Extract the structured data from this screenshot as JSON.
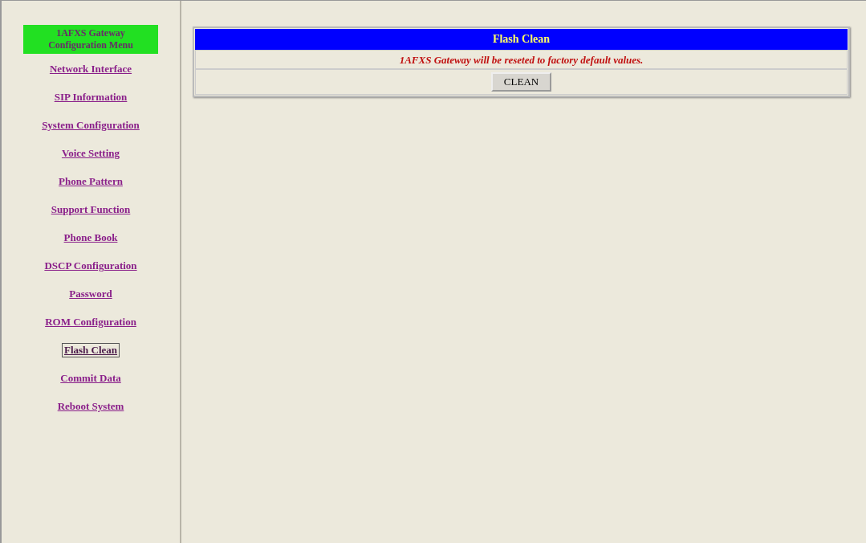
{
  "menu": {
    "title": "1AFXS Gateway Configuration Menu",
    "items": [
      {
        "label": "Network Interface",
        "selected": false
      },
      {
        "label": "SIP Information",
        "selected": false
      },
      {
        "label": "System Configuration",
        "selected": false
      },
      {
        "label": "Voice Setting",
        "selected": false
      },
      {
        "label": "Phone Pattern",
        "selected": false
      },
      {
        "label": "Support Function",
        "selected": false
      },
      {
        "label": "Phone Book",
        "selected": false
      },
      {
        "label": "DSCP Configuration",
        "selected": false
      },
      {
        "label": "Password",
        "selected": false
      },
      {
        "label": "ROM Configuration",
        "selected": false
      },
      {
        "label": "Flash Clean",
        "selected": true
      },
      {
        "label": "Commit Data",
        "selected": false
      },
      {
        "label": "Reboot System",
        "selected": false
      }
    ]
  },
  "panel": {
    "title": "Flash Clean",
    "message": "1AFXS Gateway will be reseted to factory default values.",
    "button": "CLEAN"
  }
}
